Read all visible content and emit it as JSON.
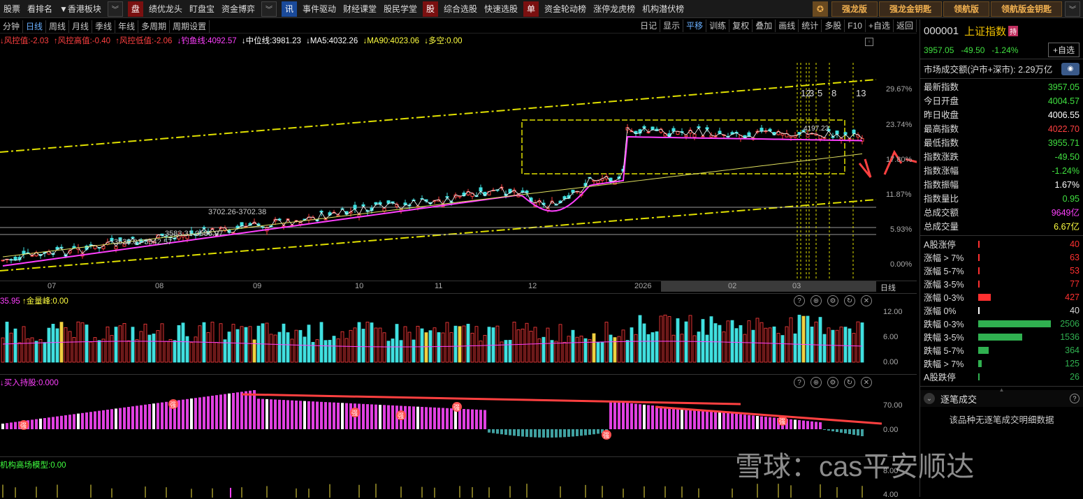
{
  "topbar": {
    "left_items": [
      "股票",
      "看排名",
      "▼香港板块"
    ],
    "groups": [
      {
        "badge": "盘",
        "items": [
          "绩优龙头",
          "盯盘宝",
          "资金博弈"
        ]
      },
      {
        "badge": "讯",
        "items": [
          "事件驱动",
          "财经课堂",
          "股民学堂"
        ]
      },
      {
        "badge": "股",
        "items": [
          "综合选股",
          "快速选股"
        ]
      },
      {
        "badge": "单",
        "items": [
          "资金轮动榜",
          "涨停龙虎榜",
          "机构潜伏榜"
        ]
      }
    ],
    "right_buttons": [
      "强龙版",
      "强龙金钥匙",
      "领航版",
      "领航版金钥匙"
    ]
  },
  "period_bar": {
    "items": [
      "分钟",
      "日线",
      "周线",
      "月线",
      "季线",
      "年线",
      "多周期",
      "周期设置"
    ],
    "active": "日线",
    "right_items": [
      "日记",
      "显示",
      "平移",
      "训练",
      "复权",
      "叠加",
      "画线",
      "统计",
      "多股",
      "F10",
      "+自选",
      "返回"
    ],
    "right_active": "平移"
  },
  "indicator_line": [
    {
      "text": "↓风控值:-2.03",
      "color": "#ff4040"
    },
    {
      "text": "↑风控高值:-0.40",
      "color": "#ff4040"
    },
    {
      "text": "↑风控低值:-2.06",
      "color": "#ff4040"
    },
    {
      "text": "↓钓鱼线:4092.57",
      "color": "#ff40ff"
    },
    {
      "text": "↓中位线:3981.23",
      "color": "#ffffff"
    },
    {
      "text": "↓MA5:4032.26",
      "color": "#ffffff"
    },
    {
      "text": "↓MA90:4023.06",
      "color": "#ffff40"
    },
    {
      "text": "↓多空:0.00",
      "color": "#ffff40"
    }
  ],
  "main_chart": {
    "y_ticks": [
      "29.67%",
      "23.74%",
      "17.80%",
      "11.87%",
      "5.93%",
      "0.00%"
    ],
    "x_ticks": [
      "07",
      "08",
      "09",
      "10",
      "11",
      "12",
      "2026",
      "02",
      "03"
    ],
    "x_unit": "日线",
    "box_label": "4197.23",
    "level_labels": [
      "3702.26-3702.38",
      "3583.31-3586.97",
      "3536.01-3542.57"
    ],
    "markers": [
      "12",
      "3",
      "5",
      "8",
      "13"
    ]
  },
  "volume_panel": {
    "header": [
      {
        "text": "35.95",
        "color": "#ff40ff"
      },
      {
        "text": "↑金量峰:0.00",
        "color": "#ffff40"
      }
    ],
    "y_ticks": [
      "12.00",
      "6.00",
      "0.00"
    ]
  },
  "hold_panel": {
    "header": [
      {
        "text": "↓买入持股:0.000",
        "color": "#ff40ff"
      }
    ],
    "y_ticks": [
      "70.00",
      "0.00"
    ],
    "strong_label": "强"
  },
  "model_panel": {
    "header": [
      {
        "text": "机构高场模型:0.00",
        "color": "#40ff40"
      }
    ],
    "y_ticks": [
      "8.00",
      "4.00"
    ]
  },
  "right_panel": {
    "code": "000001",
    "name": "上证指数",
    "tag": "持",
    "price": "3957.05",
    "change": "-49.50",
    "pct": "-1.24%",
    "add_btn": "+自选",
    "market_turnover": "市场成交额(沪市+深市): 2.29万亿",
    "stats": [
      {
        "label": "最新指数",
        "value": "3957.05",
        "color": "#40e040"
      },
      {
        "label": "今日开盘",
        "value": "4004.57",
        "color": "#40e040"
      },
      {
        "label": "昨日收盘",
        "value": "4006.55",
        "color": "#ffffff"
      },
      {
        "label": "最高指数",
        "value": "4022.70",
        "color": "#ff4040"
      },
      {
        "label": "最低指数",
        "value": "3955.71",
        "color": "#40e040"
      },
      {
        "label": "指数涨跌",
        "value": "-49.50",
        "color": "#40e040"
      },
      {
        "label": "指数涨幅",
        "value": "-1.24%",
        "color": "#40e040"
      },
      {
        "label": "指数振幅",
        "value": "1.67%",
        "color": "#ffffff"
      },
      {
        "label": "指数量比",
        "value": "0.95",
        "color": "#40e040"
      },
      {
        "label": "总成交额",
        "value": "9649亿",
        "color": "#ff40ff"
      },
      {
        "label": "总成交量",
        "value": "6.67亿",
        "color": "#ffff40"
      }
    ],
    "distribution": [
      {
        "label": "A股涨停",
        "value": "40",
        "color": "#ff3030",
        "share": 0.002
      },
      {
        "label": "涨幅 > 7%",
        "value": "63",
        "color": "#ff3030",
        "share": 0.003
      },
      {
        "label": "涨幅 5-7%",
        "value": "53",
        "color": "#ff3030",
        "share": 0.002
      },
      {
        "label": "涨幅 3-5%",
        "value": "77",
        "color": "#ff3030",
        "share": 0.003
      },
      {
        "label": "涨幅 0-3%",
        "value": "427",
        "color": "#ff3030",
        "share": 0.17
      },
      {
        "label": "涨幅 0%",
        "value": "40",
        "color": "#ffffff",
        "share": 0.002
      },
      {
        "label": "跌幅 0-3%",
        "value": "2506",
        "color": "#30b050",
        "share": 1.0
      },
      {
        "label": "跌幅 3-5%",
        "value": "1536",
        "color": "#30b050",
        "share": 0.61
      },
      {
        "label": "跌幅 5-7%",
        "value": "364",
        "color": "#30b050",
        "share": 0.145
      },
      {
        "label": "跌幅 > 7%",
        "value": "125",
        "color": "#30b050",
        "share": 0.05
      },
      {
        "label": "A股跌停",
        "value": "26",
        "color": "#30b050",
        "share": 0.002
      }
    ],
    "trades_title": "逐笔成交",
    "trades_empty": "该品种无逐笔成交明细数据"
  },
  "watermark": "雪球：cas平安顺达"
}
